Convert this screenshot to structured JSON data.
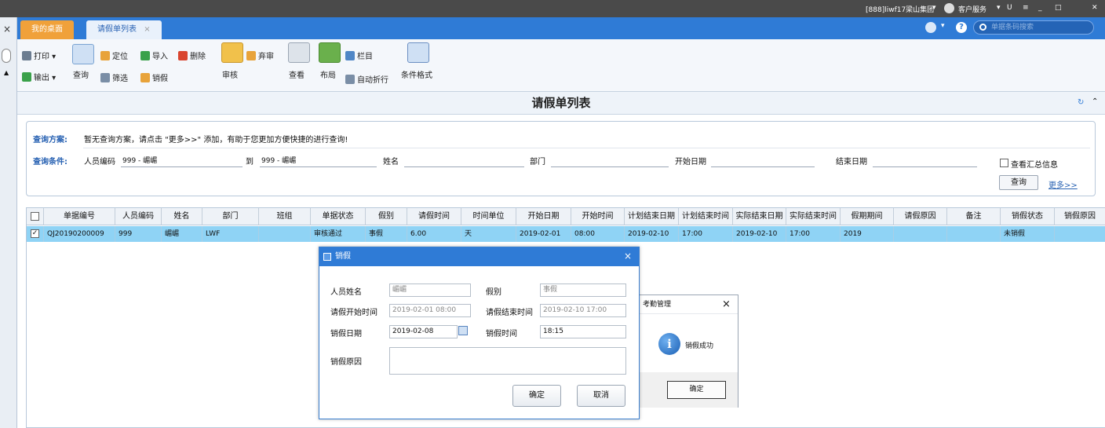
{
  "titlebar": {
    "company": "[888]liwf17梁山集团",
    "service": "客户服务",
    "icons": [
      "dropdown-icon",
      "headset-icon",
      "pin-icon",
      "menu-icon",
      "minimize-icon",
      "restore-icon",
      "close-icon"
    ]
  },
  "tabs": [
    {
      "label": "我的桌面"
    },
    {
      "label": "请假单列表",
      "close": "×"
    }
  ],
  "search": {
    "placeholder": "单据条码搜索"
  },
  "toolbar": {
    "print": "打印",
    "export": "输出",
    "query": "查询",
    "locate": "定位",
    "filter": "筛选",
    "import": "导入",
    "delete": "删除",
    "cancel_leave": "销假",
    "audit": "审核",
    "abandon": "弃审",
    "view": "查看",
    "layout": "布局",
    "columns": "栏目",
    "autowrap": "自动折行",
    "condfmt": "条件格式"
  },
  "page": {
    "title": "请假单列表"
  },
  "query": {
    "scheme_label": "查询方案:",
    "scheme_text": "暂无查询方案，请点击 \"更多>>\" 添加，有助于您更加方便快捷的进行查询!",
    "cond_label": "查询条件:",
    "emp_code": "人员编码",
    "emp_from": "999 - 嵋嵋",
    "to": "到",
    "emp_to": "999 - 嵋嵋",
    "name": "姓名",
    "dept": "部门",
    "start_date": "开始日期",
    "end_date": "结束日期",
    "summary": "查看汇总信息",
    "query_btn": "查询",
    "more": "更多>>"
  },
  "grid": {
    "headers": [
      "单据编号",
      "人员编码",
      "姓名",
      "部门",
      "班组",
      "单据状态",
      "假别",
      "请假时间",
      "时间单位",
      "开始日期",
      "开始时间",
      "计划结束日期",
      "计划结束时间",
      "实际结束日期",
      "实际结束时间",
      "假期期间",
      "请假原因",
      "备注",
      "销假状态",
      "销假原因"
    ],
    "row": [
      "QJ20190200009",
      "999",
      "嵋嵋",
      "LWF",
      "",
      "审核通过",
      "事假",
      "6.00",
      "天",
      "2019-02-01",
      "08:00",
      "2019-02-10",
      "17:00",
      "2019-02-10",
      "17:00",
      "2019",
      "",
      "",
      "未销假",
      ""
    ]
  },
  "dialog": {
    "title": "销假",
    "close": "×",
    "name_label": "人员姓名",
    "name_value": "嵋嵋",
    "type_label": "假别",
    "type_value": "事假",
    "start_label": "请假开始时间",
    "start_value": "2019-02-01 08:00",
    "end_label": "请假结束时间",
    "end_value": "2019-02-10 17:00",
    "date_label": "销假日期",
    "date_value": "2019-02-08",
    "time_label": "销假时间",
    "time_value": "18:15",
    "reason_label": "销假原因",
    "ok": "确定",
    "cancel": "取消"
  },
  "msgbox": {
    "title": "考勤管理",
    "close": "×",
    "text": "销假成功",
    "ok": "确定"
  }
}
